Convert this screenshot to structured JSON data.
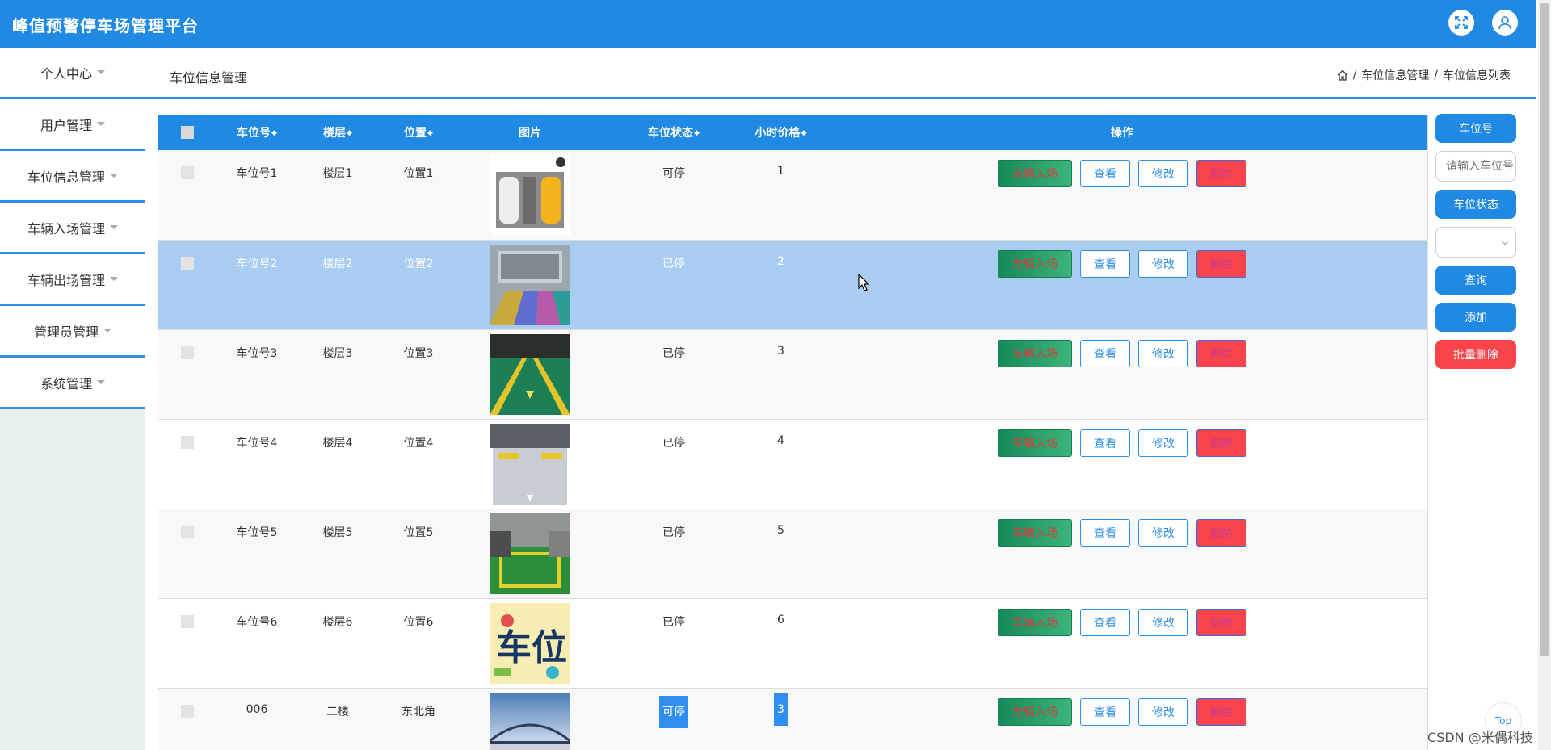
{
  "app": {
    "title": "峰值预警停车场管理平台"
  },
  "header_icons": {
    "fullscreen": "fullscreen-icon",
    "user": "user-icon"
  },
  "sidebar": {
    "items": [
      {
        "label": "个人中心"
      },
      {
        "label": "用户管理"
      },
      {
        "label": "车位信息管理"
      },
      {
        "label": "车辆入场管理"
      },
      {
        "label": "车辆出场管理"
      },
      {
        "label": "管理员管理"
      },
      {
        "label": "系统管理"
      }
    ]
  },
  "page": {
    "title": "车位信息管理",
    "breadcrumb": [
      "车位信息管理",
      "车位信息列表"
    ],
    "separator": "/"
  },
  "table": {
    "headers": {
      "space_no": "车位号",
      "floor": "楼层",
      "location": "位置",
      "image": "图片",
      "status": "车位状态",
      "hourly_price": "小时价格",
      "actions": "操作"
    },
    "sort_glyph": "◆",
    "rows": [
      {
        "space_no": "车位号1",
        "floor": "楼层1",
        "location": "位置1",
        "status": "可停",
        "hourly_price": "1",
        "image": "parking-top-view"
      },
      {
        "space_no": "车位号2",
        "floor": "楼层2",
        "location": "位置2",
        "status": "已停",
        "hourly_price": "2",
        "image": "indoor-colored-spaces"
      },
      {
        "space_no": "车位号3",
        "floor": "楼层3",
        "location": "位置3",
        "status": "已停",
        "hourly_price": "3",
        "image": "green-floor-yellow-lines"
      },
      {
        "space_no": "车位号4",
        "floor": "楼层4",
        "location": "位置4",
        "status": "已停",
        "hourly_price": "4",
        "image": "grey-floor-stoppers"
      },
      {
        "space_no": "车位号5",
        "floor": "楼层5",
        "location": "位置5",
        "status": "已停",
        "hourly_price": "5",
        "image": "green-space-cars"
      },
      {
        "space_no": "车位号6",
        "floor": "楼层6",
        "location": "位置6",
        "status": "已停",
        "hourly_price": "6",
        "image": "cartoon-chewei-logo"
      },
      {
        "space_no": "006",
        "floor": "二楼",
        "location": "东北角",
        "status": "可停",
        "hourly_price": "3",
        "image": "bridge-dusk"
      }
    ],
    "actions": {
      "enter": "车辆入场",
      "view": "查看",
      "edit": "修改",
      "delete": "删除"
    }
  },
  "filters": {
    "space_no_label": "车位号",
    "space_no_placeholder": "请输入车位号",
    "status_label": "车位状态",
    "status_value": "",
    "search": "查询",
    "add": "添加",
    "batch_delete": "批量删除"
  },
  "floating": {
    "top": "Top"
  },
  "watermark": "CSDN @米偶科技",
  "colors": {
    "primary": "#1f89e3",
    "danger": "#f9444c",
    "enter": "#16895a",
    "highlight_row": "#a8cdf1"
  }
}
